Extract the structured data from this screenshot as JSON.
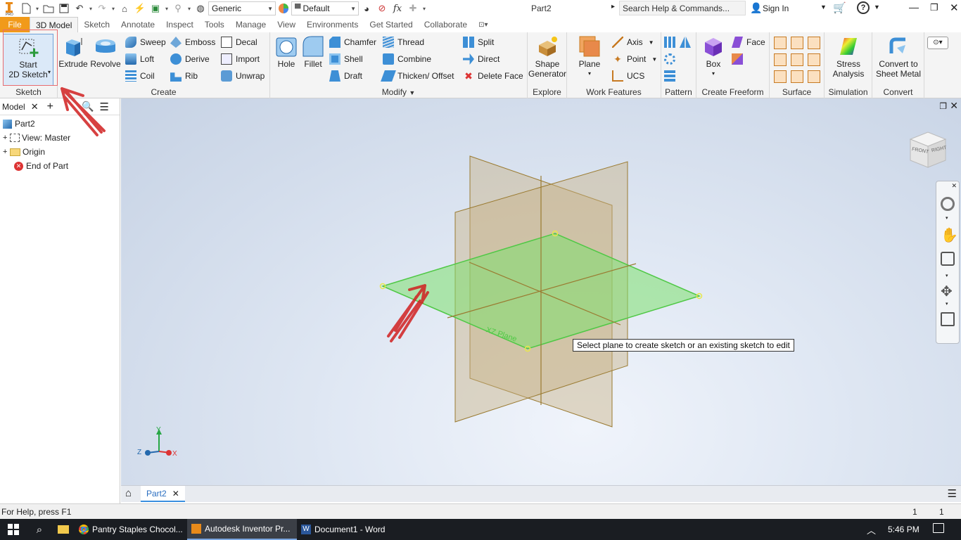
{
  "titlebar": {
    "appearance_combo": "Generic",
    "material_combo": "Default",
    "document_title": "Part2",
    "search_placeholder": "Search Help & Commands...",
    "sign_in": "Sign In"
  },
  "tabs": [
    "File",
    "3D Model",
    "Sketch",
    "Annotate",
    "Inspect",
    "Tools",
    "Manage",
    "View",
    "Environments",
    "Get Started",
    "Collaborate"
  ],
  "ribbon": {
    "sketch": {
      "title": "Sketch",
      "start_line1": "Start",
      "start_line2": "2D Sketch"
    },
    "create": {
      "title": "Create",
      "extrude": "Extrude",
      "revolve": "Revolve",
      "sweep": "Sweep",
      "loft": "Loft",
      "coil": "Coil",
      "emboss": "Emboss",
      "derive": "Derive",
      "rib": "Rib",
      "decal": "Decal",
      "import": "Import",
      "unwrap": "Unwrap"
    },
    "modify": {
      "title": "Modify",
      "hole": "Hole",
      "fillet": "Fillet",
      "chamfer": "Chamfer",
      "shell": "Shell",
      "draft": "Draft",
      "thread": "Thread",
      "combine": "Combine",
      "thicken": "Thicken/ Offset",
      "split": "Split",
      "direct": "Direct",
      "delete_face": "Delete Face"
    },
    "explore": {
      "title": "Explore",
      "shape_line1": "Shape",
      "shape_line2": "Generator"
    },
    "work_features": {
      "title": "Work Features",
      "plane": "Plane",
      "axis": "Axis",
      "point": "Point",
      "ucs": "UCS"
    },
    "pattern": {
      "title": "Pattern"
    },
    "freeform": {
      "title": "Create Freeform",
      "box": "Box",
      "face": "Face"
    },
    "surface": {
      "title": "Surface"
    },
    "simulation": {
      "title": "Simulation",
      "stress_line1": "Stress",
      "stress_line2": "Analysis"
    },
    "convert": {
      "title": "Convert",
      "convert_line1": "Convert to",
      "convert_line2": "Sheet Metal"
    }
  },
  "browser": {
    "tab_label": "Model",
    "items": [
      "Part2",
      "View: Master",
      "Origin",
      "End of Part"
    ]
  },
  "viewport": {
    "tooltip": "Select plane to create sketch or an existing sketch to edit",
    "plane_label": "XZ Plane",
    "viewcube_front": "FRONT",
    "viewcube_right": "RIGHT",
    "triad": {
      "x": "X",
      "y": "Y",
      "z": "Z"
    }
  },
  "doc_tab": "Part2",
  "status": {
    "help": "For Help, press F1",
    "count1": "1",
    "count2": "1"
  },
  "taskbar": {
    "items": [
      "Pantry Staples Chocol...",
      "Autodesk Inventor Pr...",
      "Document1 - Word"
    ],
    "time": "5:46 PM"
  },
  "colors": {
    "file_tab": "#f19a1a",
    "plane_selected": "#7ee06e",
    "plane_other": "#b8a27a",
    "highlight_box": "#e0353a"
  }
}
